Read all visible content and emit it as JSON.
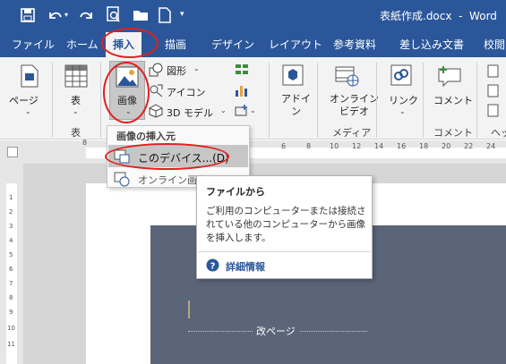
{
  "window": {
    "title": "表紙作成.docx  -  Word"
  },
  "tabs": [
    {
      "label": "ファイル"
    },
    {
      "label": "ホーム"
    },
    {
      "label": "挿入"
    },
    {
      "label": "描画"
    },
    {
      "label": "デザイン"
    },
    {
      "label": "レイアウト"
    },
    {
      "label": "参考資料"
    },
    {
      "label": "差し込み文書"
    },
    {
      "label": "校閲"
    }
  ],
  "ribbon": {
    "page_label": "ページ",
    "table_label": "表",
    "table_group": "表",
    "image_label": "画像",
    "shapes_label": "図形",
    "icons_label": "アイコン",
    "model3d_label": "3D モデル",
    "addins_label": "アドイ\nン",
    "online_video_label": "オンライン\nビデオ",
    "media_group": "メディア",
    "link_label": "リンク",
    "comment_label": "コメント",
    "comment_group": "コメント",
    "header_group_partial": "ヘッ"
  },
  "dropdown": {
    "header": "画像の挿入元",
    "items": [
      {
        "label": "このデバイス...(D)"
      },
      {
        "label": "オンライン画像(O)"
      }
    ]
  },
  "tooltip": {
    "title": "ファイルから",
    "body": "ご利用のコンピューターまたは接続されている他のコンピューターから画像を挿入します。",
    "link": "詳細情報"
  },
  "document": {
    "page_break_label": "改ページ"
  },
  "ruler": {
    "left_num": "8",
    "right_nums": [
      "6",
      "8",
      "10",
      "12",
      "14",
      "16",
      "18",
      "20",
      "22",
      "24"
    ]
  },
  "vruler": {
    "nums": [
      "1",
      "2",
      "3",
      "4",
      "5",
      "6",
      "7",
      "8",
      "9",
      "10",
      "11"
    ]
  },
  "colors": {
    "accent": "#2b579a",
    "highlight_oval": "#e02020",
    "cover_fill": "#5a6579"
  }
}
